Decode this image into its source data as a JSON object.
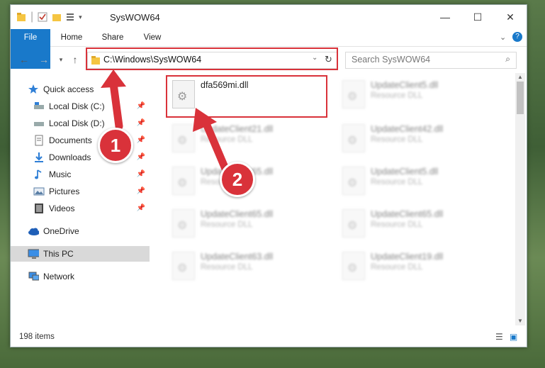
{
  "window": {
    "title": "SysWOW64"
  },
  "ribbon": {
    "file": "File",
    "home": "Home",
    "share": "Share",
    "view": "View"
  },
  "address": {
    "path": "C:\\Windows\\SysWOW64",
    "search_placeholder": "Search SysWOW64"
  },
  "nav": {
    "quick_access": "Quick access",
    "items": [
      {
        "label": "Local Disk (C:)"
      },
      {
        "label": "Local Disk (D:)"
      },
      {
        "label": "Documents"
      },
      {
        "label": "Downloads"
      },
      {
        "label": "Music"
      },
      {
        "label": "Pictures"
      },
      {
        "label": "Videos"
      }
    ],
    "onedrive": "OneDrive",
    "thispc": "This PC",
    "network": "Network"
  },
  "files": [
    {
      "name": "dfa569mi.dll",
      "type": ""
    },
    {
      "name": "UpdateClient5.dll",
      "type": "Resource DLL"
    },
    {
      "name": "UpdateClient21.dll",
      "type": "Resource DLL"
    },
    {
      "name": "UpdateClient42.dll",
      "type": "Resource DLL"
    },
    {
      "name": "UpdateClient65.dll",
      "type": "Resource DLL"
    },
    {
      "name": "UpdateClient5.dll",
      "type": "Resource DLL"
    },
    {
      "name": "UpdateClient65.dll",
      "type": "Resource DLL"
    },
    {
      "name": "UpdateClient65.dll",
      "type": "Resource DLL"
    },
    {
      "name": "UpdateClient63.dll",
      "type": "Resource DLL"
    },
    {
      "name": "UpdateClient19.dll",
      "type": "Resource DLL"
    }
  ],
  "status": {
    "count": "198 items"
  },
  "badges": {
    "one": "1",
    "two": "2"
  },
  "colors": {
    "accent": "#1979ca",
    "highlight": "#d9323a"
  }
}
